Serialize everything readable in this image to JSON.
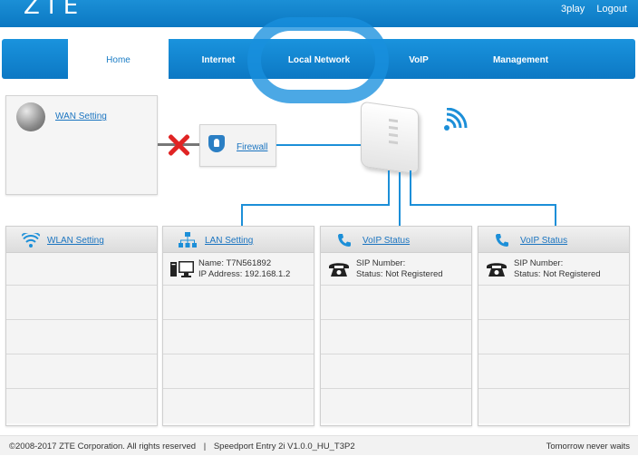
{
  "header": {
    "logo": "ZTE",
    "links": {
      "play": "3play",
      "logout": "Logout"
    }
  },
  "nav": {
    "tabs": [
      {
        "label": "Home",
        "active": true
      },
      {
        "label": "Internet",
        "active": false
      },
      {
        "label": "Local Network",
        "active": false
      },
      {
        "label": "VoIP",
        "active": false
      },
      {
        "label": "Management",
        "active": false
      }
    ]
  },
  "topology": {
    "wan_link": "WAN Setting",
    "firewall_link": "Firewall",
    "wan_status": "disconnected"
  },
  "cards": {
    "wlan": {
      "title": "WLAN Setting"
    },
    "lan": {
      "title": "LAN Setting",
      "name": "Name: T7N561892",
      "ip": "IP Address: 192.168.1.2"
    },
    "voip1": {
      "title": "VoIP Status",
      "sip": "SIP Number:",
      "status": "Status: Not Registered"
    },
    "voip2": {
      "title": "VoIP Status",
      "sip": "SIP Number:",
      "status": "Status: Not Registered"
    }
  },
  "footer": {
    "copyright": "©2008-2017 ZTE Corporation. All rights reserved",
    "separator": "|",
    "version": "Speedport Entry 2i V1.0.0_HU_T3P2",
    "slogan": "Tomorrow never waits"
  },
  "colors": {
    "brand_blue": "#0b78c2",
    "link_blue": "#1a74c0",
    "error_red": "#e02424"
  }
}
